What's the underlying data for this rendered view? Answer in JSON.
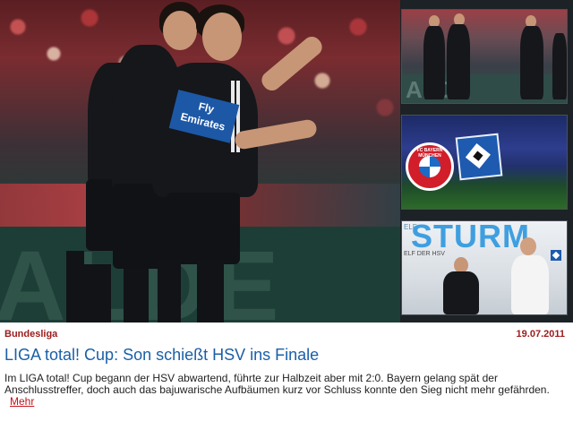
{
  "article": {
    "category": "Bundesliga",
    "date": "19.07.2011",
    "headline": "LIGA total! Cup: Son schießt HSV ins Finale",
    "teaser": "Im LIGA total! Cup begann der HSV abwartend, führte zur Halbzeit aber mit 2:0. Bayern gelang spät der Anschlusstreffer, doch auch das bajuwarische Aufbäumen kurz vor Schluss konnte den Sieg nicht mehr gefährden.",
    "more_label": "Mehr"
  },
  "hero": {
    "background_text": "ALDE",
    "sponsor_text": "Fly Emirates"
  },
  "thumbnails": {
    "t1_wall": "ALDE",
    "t2_bayern_text": "FC BAYERN MÜNCHEN",
    "t3_small": "ELF",
    "t3_title": "STURM",
    "t3_sub": "ELF DER HSV"
  },
  "colors": {
    "category": "#9a1c1c",
    "headline": "#1a5fa8",
    "more_link": "#c0141c",
    "hsv_blue": "#1e5ab0"
  }
}
